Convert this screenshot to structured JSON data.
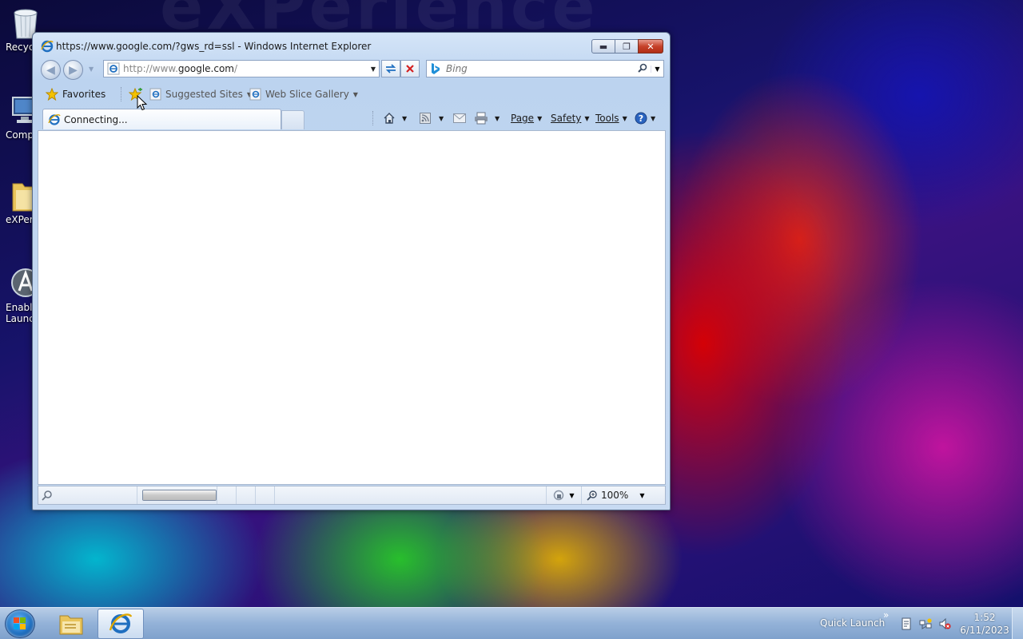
{
  "wallpaper": {
    "text": "eXPerience"
  },
  "desktop": {
    "icons": [
      {
        "label": "Recyc",
        "icon": "recycle-bin-icon"
      },
      {
        "label": "Comp",
        "icon": "computer-icon"
      },
      {
        "label": "eXPer",
        "icon": "folder-icon"
      },
      {
        "label": "Enable",
        "label2": "Launc",
        "icon": "app-icon"
      }
    ]
  },
  "browser": {
    "window_title": "https://www.google.com/?gws_rd=ssl - Windows Internet Explorer",
    "window_buttons": {
      "minimize": "▬",
      "maximize": "❐",
      "close": "✕"
    },
    "address": {
      "prefix": "http://www.",
      "host": "google.com",
      "suffix": "/"
    },
    "search": {
      "placeholder": "Bing"
    },
    "favorites_bar": {
      "favorites_label": "Favorites",
      "items": [
        {
          "label": "Suggested Sites"
        },
        {
          "label": "Web Slice Gallery"
        }
      ]
    },
    "tab": {
      "title": "Connecting..."
    },
    "command_bar": {
      "page": "Page",
      "safety": "Safety",
      "tools": "Tools"
    },
    "status_bar": {
      "zoom": "100%",
      "progress": 1.0
    }
  },
  "taskbar": {
    "quick_launch": "Quick Launch",
    "time": "1:52",
    "date": "6/11/2023"
  },
  "colors": {
    "ie_blue": "#1f6fc0",
    "close_red": "#c6412a",
    "stop_red": "#d42020",
    "favorites_star": "#f4c200"
  }
}
